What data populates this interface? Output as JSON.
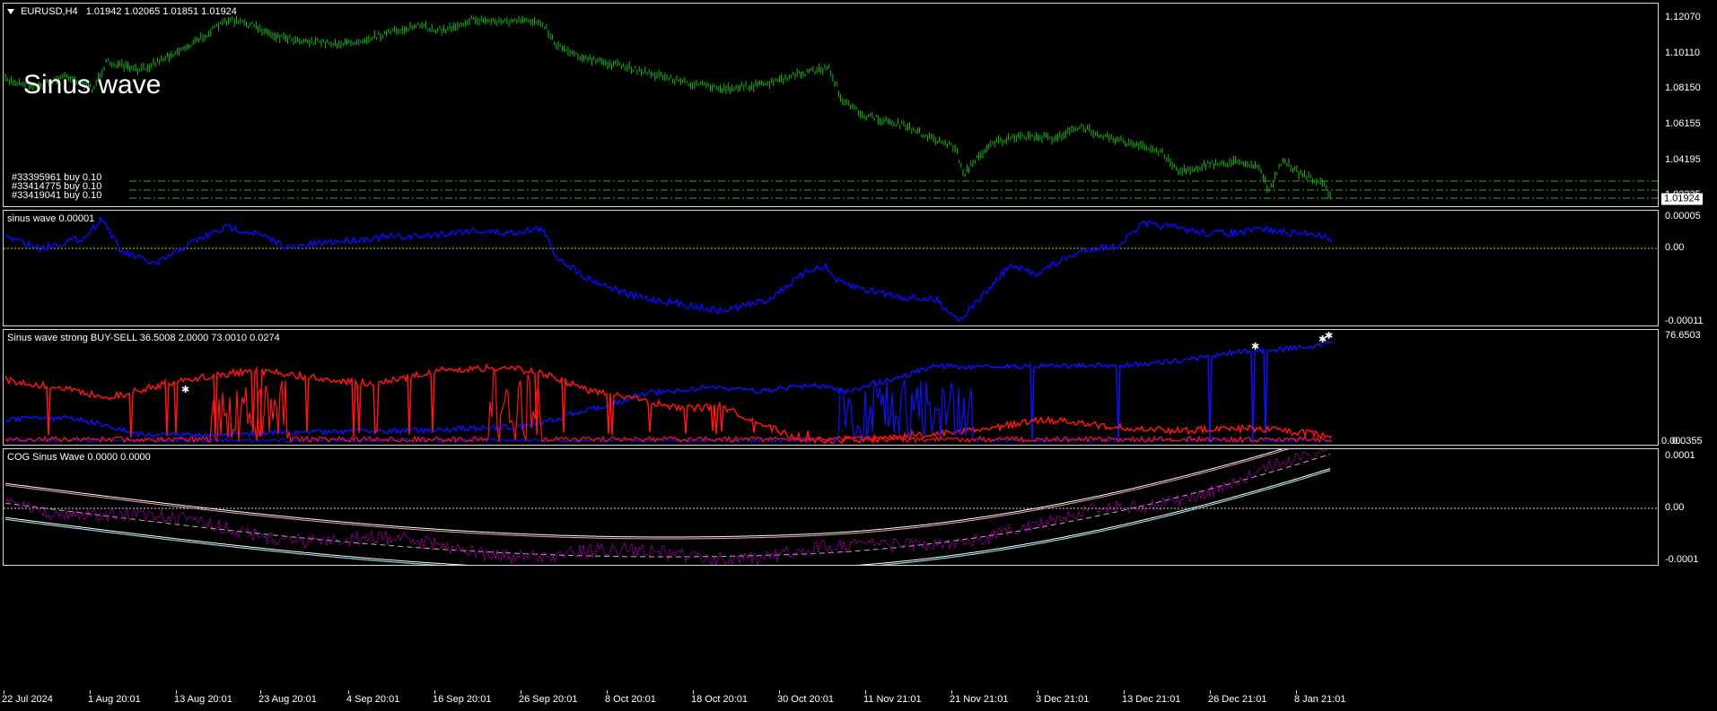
{
  "main": {
    "symbol_label": "EURUSD,H4",
    "ohlc": "1.01942 1.02065 1.01851 1.01924",
    "overlay_text": "Sinus wave",
    "current_price": "1.01924",
    "trades": [
      "#33395961 buy 0.10",
      "#33414775 buy 0.10",
      "#33419041 buy 0.10"
    ],
    "price_ticks": [
      "1.12070",
      "1.10110",
      "1.08150",
      "1.06155",
      "1.04195",
      "1.02235"
    ]
  },
  "sinus": {
    "label": "sinus wave 0.00001",
    "ticks": [
      "0.00005",
      "0.00",
      "-0.00011"
    ]
  },
  "strong": {
    "label": "Sinus wave strong BUY-SELL 36.5008 2.0000 73.0010 0.0274",
    "ticks": [
      "76.6503",
      "0.0355"
    ],
    "tick_zero": "0.00"
  },
  "cog": {
    "label": "COG Sinus Wave 0.0000 0.0000",
    "ticks": [
      "0.0001",
      "0.00",
      "-0.0001"
    ]
  },
  "time_labels": [
    "22 Jul 2024",
    "1 Aug 20:01",
    "13 Aug 20:01",
    "23 Aug 20:01",
    "4 Sep 20:01",
    "16 Sep 20:01",
    "26 Sep 20:01",
    "8 Oct 20:01",
    "18 Oct 20:01",
    "30 Oct 20:01",
    "11 Nov 21:01",
    "21 Nov 21:01",
    "3 Dec 21:01",
    "13 Dec 21:01",
    "26 Dec 21:01",
    "8 Jan 21:01"
  ],
  "colors": {
    "price": "#18b818",
    "sinus": "#0a0aff",
    "buy": "#1010ff",
    "sell": "#ff1515",
    "cog_main": "#b000b0",
    "cog_upper": "#f4a0a0",
    "cog_lower": "#8ad0d8",
    "trade_line": "#18b818",
    "zero_line": "#d8c000"
  },
  "icons": {
    "menu": "triangle-down-icon"
  }
}
